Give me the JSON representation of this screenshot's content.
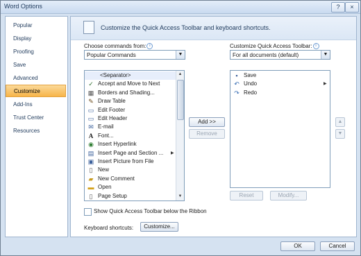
{
  "window": {
    "title": "Word Options",
    "help_label": "?",
    "close_label": "×"
  },
  "sidebar": {
    "items": [
      {
        "label": "Popular"
      },
      {
        "label": "Display"
      },
      {
        "label": "Proofing"
      },
      {
        "label": "Save"
      },
      {
        "label": "Advanced"
      },
      {
        "label": "Customize",
        "active": true
      },
      {
        "label": "Add-Ins"
      },
      {
        "label": "Trust Center"
      },
      {
        "label": "Resources"
      }
    ]
  },
  "header": {
    "text": "Customize the Quick Access Toolbar and keyboard shortcuts."
  },
  "left_panel": {
    "choose_label": "Choose commands from:",
    "choose_value": "Popular Commands",
    "commands": [
      {
        "label": "<Separator>",
        "icon": "none"
      },
      {
        "label": "Accept and Move to Next",
        "icon": "accept-icon"
      },
      {
        "label": "Borders and Shading...",
        "icon": "borders-icon"
      },
      {
        "label": "Draw Table",
        "icon": "draw-table-icon"
      },
      {
        "label": "Edit Footer",
        "icon": "footer-icon"
      },
      {
        "label": "Edit Header",
        "icon": "header-icon"
      },
      {
        "label": "E-mail",
        "icon": "email-icon"
      },
      {
        "label": "Font...",
        "icon": "font-icon"
      },
      {
        "label": "Insert Hyperlink",
        "icon": "hyperlink-icon"
      },
      {
        "label": "Insert Page and Section ...",
        "icon": "page-section-icon"
      },
      {
        "label": "Insert Picture from File",
        "icon": "picture-icon"
      },
      {
        "label": "New",
        "icon": "new-document-icon"
      },
      {
        "label": "New Comment",
        "icon": "comment-icon"
      },
      {
        "label": "Open",
        "icon": "folder-icon"
      },
      {
        "label": "Page Setup",
        "icon": "page-setup-icon"
      }
    ],
    "show_below_label": "Show Quick Access Toolbar below the Ribbon",
    "keyboard_label": "Keyboard shortcuts:",
    "customize_button": "Customize..."
  },
  "middle": {
    "add_button": "Add >>",
    "remove_button": "Remove"
  },
  "right_panel": {
    "customize_label": "Customize Quick Access Toolbar:",
    "customize_value": "For all documents (default)",
    "items": [
      {
        "label": "Save",
        "icon": "save-icon"
      },
      {
        "label": "Undo",
        "icon": "undo-icon"
      },
      {
        "label": "Redo",
        "icon": "redo-icon"
      }
    ],
    "reset_button": "Reset",
    "modify_button": "Modify...",
    "move_up": "▲",
    "move_down": "▼"
  },
  "footer": {
    "ok_button": "OK",
    "cancel_button": "Cancel"
  }
}
